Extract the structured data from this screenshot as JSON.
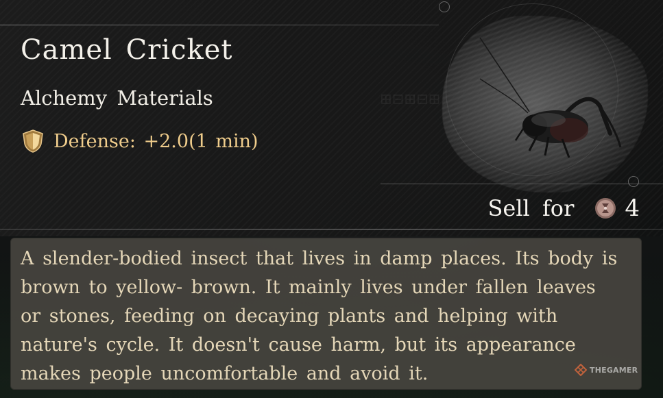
{
  "item": {
    "name": "Camel Cricket",
    "category": "Alchemy Materials",
    "effect": {
      "icon": "shield-icon",
      "text": "Defense: +2.0(1 min)",
      "color": "#f0cd8c"
    },
    "image_icon": "camel-cricket-icon"
  },
  "sell": {
    "label": "Sell for",
    "currency_icon": "coin-icon",
    "price": "4"
  },
  "description": "A slender-bodied insect that lives in damp places. Its body is brown to yellow- brown. It mainly lives under fallen leaves or stones, feeding on decaying plants and helping with nature's cycle. It doesn't cause harm, but its appearance makes people uncomfortable and avoid it.",
  "watermark": {
    "text": "THEGAMER",
    "icon": "thegamer-logo-icon"
  },
  "colors": {
    "description_text": "#e5d7b8",
    "description_bg": "#46443f",
    "title_text": "#f4f1ea"
  }
}
